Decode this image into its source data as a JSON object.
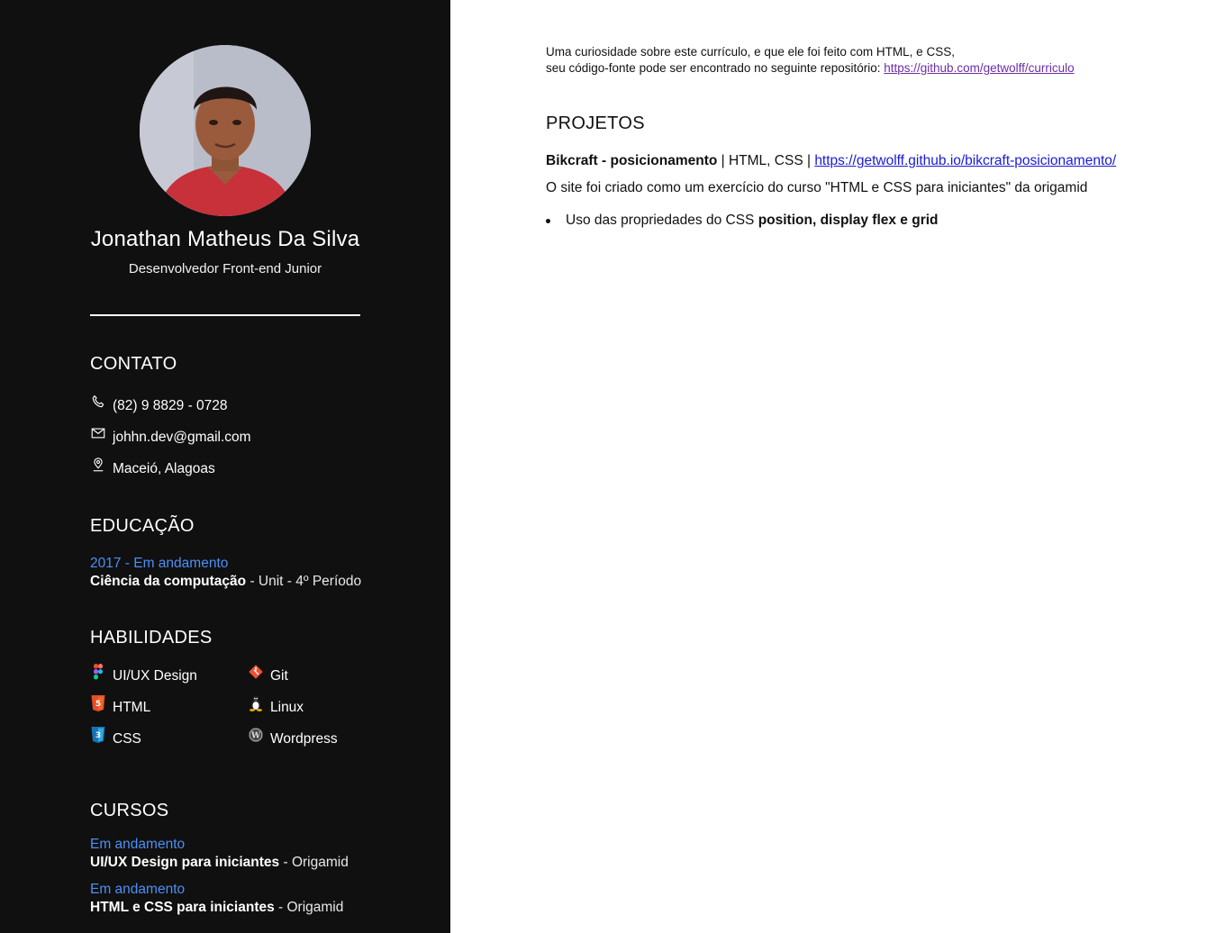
{
  "profile": {
    "name": "Jonathan Matheus Da Silva",
    "role": "Desenvolvedor Front-end Junior"
  },
  "contact": {
    "title": "CONTATO",
    "items": [
      {
        "icon": "phone-icon",
        "text": "(82) 9 8829 - 0728"
      },
      {
        "icon": "mail-icon",
        "text": "johhn.dev@gmail.com"
      },
      {
        "icon": "location-icon",
        "text": "Maceió, Alagoas"
      }
    ]
  },
  "education": {
    "title": "EDUCAÇÃO",
    "items": [
      {
        "date": "2017 - Em andamento",
        "course": "Ciência da computação",
        "detail": " - Unit - 4º Período"
      }
    ]
  },
  "skills": {
    "title": "HABILIDADES",
    "items": [
      {
        "icon": "figma-icon",
        "label": "UI/UX Design"
      },
      {
        "icon": "git-icon",
        "label": "Git"
      },
      {
        "icon": "html5-icon",
        "label": "HTML"
      },
      {
        "icon": "linux-icon",
        "label": "Linux"
      },
      {
        "icon": "css3-icon",
        "label": "CSS"
      },
      {
        "icon": "wordpress-icon",
        "label": "Wordpress"
      }
    ]
  },
  "courses": {
    "title": "CURSOS",
    "items": [
      {
        "date": "Em andamento",
        "name": "UI/UX Design para iniciantes",
        "detail": " - Origamid"
      },
      {
        "date": "Em andamento",
        "name": "HTML e CSS para iniciantes",
        "detail": " - Origamid"
      }
    ]
  },
  "main": {
    "note_line1": "Uma curiosidade sobre este currículo, e que ele foi feito com HTML, e CSS,",
    "note_line2": "seu código-fonte pode ser encontrado no seguinte repositório: ",
    "note_link": "https://github.com/getwolff/curriculo",
    "projects_title": "PROJETOS",
    "projects": [
      {
        "name": "Bikcraft - posicionamento",
        "tech": " | HTML, CSS | ",
        "link": "https://getwolff.github.io/bikcraft-posicionamento/",
        "description": "O site foi criado como um exercício do curso \"HTML e CSS para iniciantes\" da origamid",
        "bullet_text": "Uso das propriedades do CSS ",
        "bullet_bold": "position, display flex e grid"
      }
    ]
  },
  "colors": {
    "sidebar_bg": "#101010",
    "accent_blue": "#4d8ff5",
    "link_blue": "#1a1ad8",
    "visited_link": "#6b2fa8"
  }
}
